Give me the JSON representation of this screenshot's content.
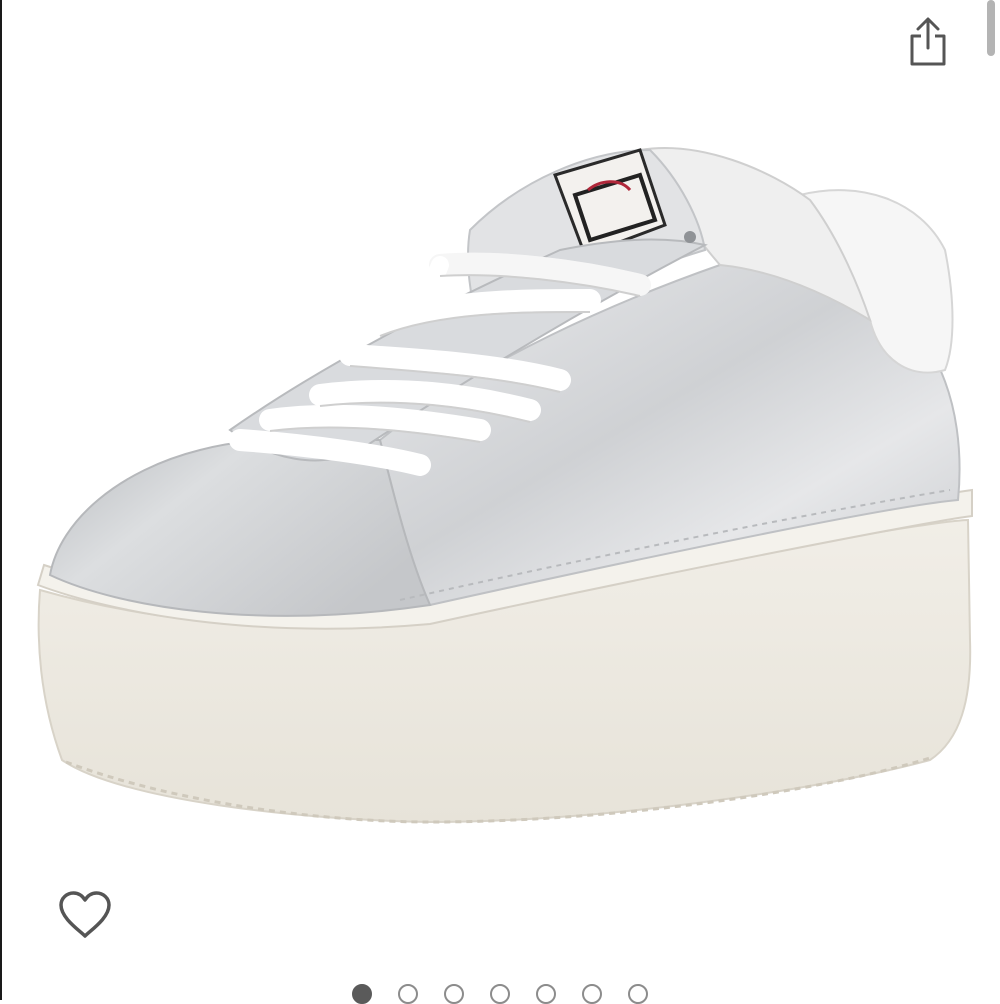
{
  "viewer": {
    "share_icon": "share-icon",
    "wishlist_icon": "heart-outline-icon",
    "image_description_icon": "sneaker-image"
  },
  "pager": {
    "total_images": 7,
    "active_index": 0
  },
  "colors": {
    "icon_gray": "#555555",
    "dot_active": "#5a5a5a",
    "dot_inactive_border": "#8c8c8c",
    "sole_cream": "#eeebe3",
    "upper_silver": "#d4d6d9"
  }
}
